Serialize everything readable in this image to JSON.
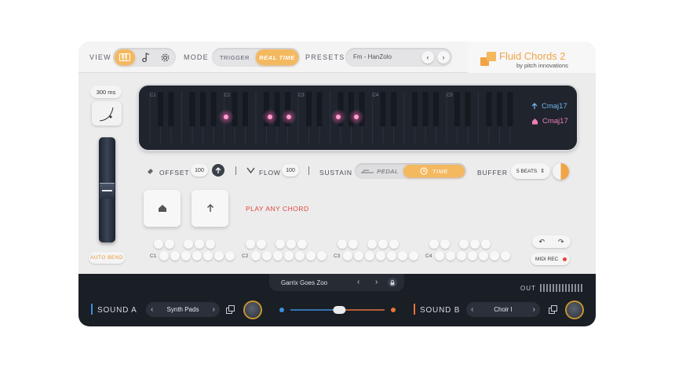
{
  "topbar": {
    "view_label": "VIEW",
    "mode_label": "MODE",
    "mode_options": [
      "TRIGGER",
      "REAL TIME"
    ],
    "presets_label": "PRESETS",
    "preset_name": "Fm - HanZolo",
    "prev_preset": "‹",
    "next_preset": "›"
  },
  "logo": {
    "title": "Fluid Chords 2",
    "subtitle": "by pitch innovations",
    "accent": "#f0a445"
  },
  "left": {
    "latency": "300 ms",
    "auto_bend": "AUTO BEND"
  },
  "display": {
    "octave_labels": [
      "C1",
      "C2",
      "C3",
      "C4",
      "C5"
    ],
    "chord_next": "Cmaj17",
    "chord_current": "Cmaj17",
    "chord_next_color": "#6fb6ef",
    "chord_current_color": "#ef7fb8",
    "highlight_color": "#e05aa5"
  },
  "controls": {
    "offset_label": "OFFSET",
    "offset_value": "100",
    "flow_label": "FLOW",
    "flow_value": "100",
    "divider": "|",
    "sustain_label": "SUSTAIN",
    "sustain_options": [
      "PEDAL",
      "TIME"
    ],
    "buffer_label": "BUFFER",
    "buffer_value": "5 BEATS"
  },
  "play_any_chord": "PLAY ANY CHORD",
  "mini_octaves": [
    "C1",
    "C2",
    "C3",
    "C4"
  ],
  "undo": "↶",
  "redo": "↷",
  "midi_rec": "MIDI REC",
  "bottom": {
    "theme_name": "Garrix Goes Zoo",
    "out_label": "OUT",
    "sound_a_label": "SOUND A",
    "sound_a_value": "Synth Pads",
    "sound_b_label": "SOUND B",
    "sound_b_value": "Choir I",
    "sound_a_color": "#3d8fe0",
    "sound_b_color": "#e8743b",
    "crossfade_level": 0.52
  }
}
